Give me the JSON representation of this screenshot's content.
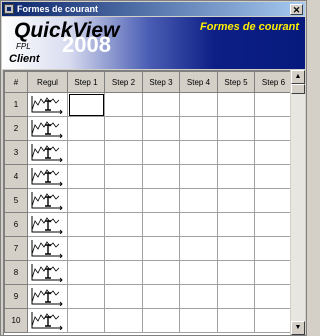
{
  "window": {
    "title": "Formes de courant",
    "close_glyph": "✕"
  },
  "banner": {
    "brand": "QuickView",
    "sub": "FPL",
    "year": "2008",
    "client": "Client",
    "form_title": "Formes de courant"
  },
  "grid": {
    "headers": [
      "#",
      "Regul",
      "Step 1",
      "Step 2",
      "Step 3",
      "Step 4",
      "Step 5",
      "Step 6"
    ],
    "rows": [
      "1",
      "2",
      "3",
      "4",
      "5",
      "6",
      "7",
      "8",
      "9",
      "10"
    ],
    "selected_cell": {
      "row": 1,
      "column": "Step 1"
    }
  },
  "scrollbar": {
    "up_glyph": "▲",
    "down_glyph": "▼"
  },
  "icons": {
    "regul": "current-waveform-icon"
  }
}
